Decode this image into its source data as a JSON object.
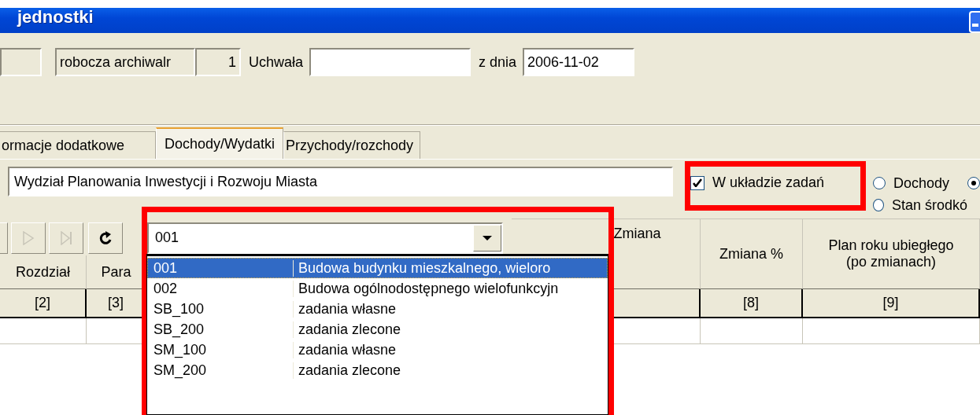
{
  "window": {
    "title": "jednostki"
  },
  "top_row": [
    {
      "kind": "box"
    },
    {
      "kind": "readonly",
      "value": "robocza archiwalr"
    },
    {
      "kind": "number",
      "value": "1"
    },
    {
      "kind": "label",
      "text": "Uchwała"
    },
    {
      "kind": "input"
    },
    {
      "kind": "label",
      "text": "z dnia"
    },
    {
      "kind": "input",
      "value": "2006-11-02"
    }
  ],
  "tabs": [
    {
      "label": "ormacje dodatkowe",
      "selected": false
    },
    {
      "label": "Dochody/Wydatki",
      "selected": true
    },
    {
      "label": "Przychody/rozchody",
      "selected": false
    }
  ],
  "unit_field": {
    "value": "Wydział Planowania Inwestycji i Rozwoju Miasta"
  },
  "task_checkbox": {
    "label": "W układzie zadań",
    "checked": true
  },
  "radios": [
    {
      "label": "Dochody",
      "selected": false
    },
    {
      "selected": true
    },
    {
      "label": "Stan środkó",
      "selected": false
    }
  ],
  "grid_toolbar": [
    {
      "kind": "play",
      "disabled": true
    },
    {
      "kind": "last",
      "disabled": true
    },
    {
      "kind": "refresh",
      "disabled": false
    }
  ],
  "combo": {
    "value": "001"
  },
  "columns": [
    {
      "label": "Rozdział",
      "number": "[2]"
    },
    {
      "label": "Para",
      "number": "[3]"
    },
    {
      "label": "Zmiana"
    },
    {
      "label": "Zmiana %",
      "number": "[8]"
    },
    {
      "label": "Plan roku ubiegłego\n(po zmianach)",
      "number": "[9]"
    }
  ],
  "dropdown": {
    "rows": [
      {
        "code": "001",
        "description": "Budowa  budynku mieszkalnego, wieloro",
        "selected": true
      },
      {
        "code": "002",
        "description": "Budowa ogólnodostępnego wielofunkcyjn",
        "selected": false
      },
      {
        "code": "SB_100",
        "description": "zadania własne",
        "selected": false
      },
      {
        "code": "SB_200",
        "description": "zadania zlecone",
        "selected": false
      },
      {
        "code": "SM_100",
        "description": "zadania własne",
        "selected": false
      },
      {
        "code": "SM_200",
        "description": "zadania zlecone",
        "selected": false
      }
    ]
  }
}
